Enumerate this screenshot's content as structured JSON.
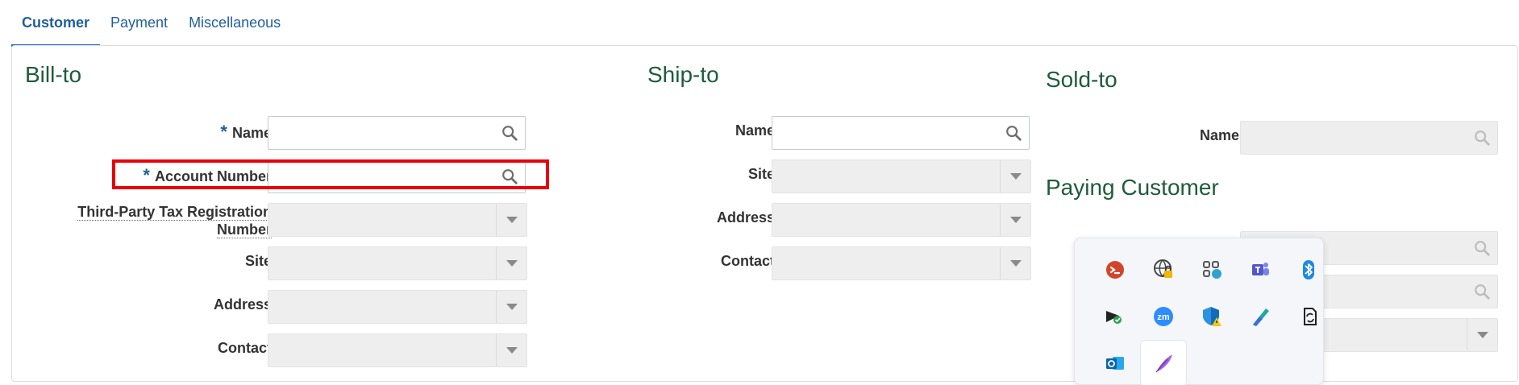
{
  "tabs": [
    {
      "label": "Customer",
      "active": true
    },
    {
      "label": "Payment",
      "active": false
    },
    {
      "label": "Miscellaneous",
      "active": false
    }
  ],
  "bill_to": {
    "title": "Bill-to",
    "fields": {
      "name": {
        "label": "Name",
        "required": true,
        "value": ""
      },
      "account_number": {
        "label": "Account Number",
        "required": true,
        "value": ""
      },
      "tax_registration": {
        "label": "Third-Party Tax Registration Number",
        "line1": "Third-Party Tax Registration",
        "line2": "Number",
        "value": ""
      },
      "site": {
        "label": "Site",
        "value": ""
      },
      "address": {
        "label": "Address",
        "value": ""
      },
      "contact": {
        "label": "Contact",
        "value": ""
      }
    }
  },
  "ship_to": {
    "title": "Ship-to",
    "fields": {
      "name": {
        "label": "Name",
        "value": ""
      },
      "site": {
        "label": "Site",
        "value": ""
      },
      "address": {
        "label": "Address",
        "value": ""
      },
      "contact": {
        "label": "Contact",
        "value": ""
      }
    }
  },
  "sold_to": {
    "title": "Sold-to",
    "fields": {
      "name": {
        "label": "Name",
        "value": ""
      }
    }
  },
  "paying_customer": {
    "title": "Paying Customer"
  },
  "required_mark": "*",
  "tray": {
    "icons": [
      "remote-desktop-icon",
      "vpn-lock-icon",
      "slack-sync-icon",
      "teams-icon",
      "bluetooth-icon",
      "security-shield-icon",
      "zoom-icon",
      "defender-warning-icon",
      "pen-app-icon",
      "sync-document-icon",
      "outlook-icon",
      "feather-icon"
    ]
  },
  "colors": {
    "link": "#1f5f9c",
    "section_title": "#1e5c3a",
    "highlight": "#e8000b"
  }
}
